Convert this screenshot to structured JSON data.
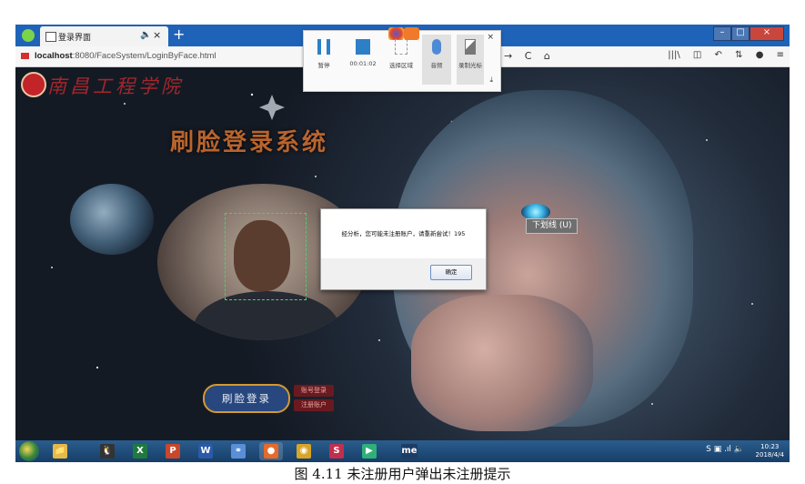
{
  "browser": {
    "tab_title": "登录界面",
    "tab_audio": "🔈",
    "tab_close": "×",
    "new_tab": "+",
    "url_host": "localhost",
    "url_path": ":8080/FaceSystem/LoginByFace.html",
    "window": {
      "minimize": "–",
      "maximize": "□",
      "close": "×"
    },
    "nav_icons": {
      "forward": "→",
      "reload": "C",
      "home": "⌂"
    },
    "right_icons": {
      "library": "|||\\",
      "sidebar": "◫",
      "undo": "↶",
      "tools": "⇅",
      "chat": "●",
      "menu": "≡"
    }
  },
  "recorder": {
    "pause_label": "暂停",
    "timer": "00:01:02",
    "area_label": "选择区域",
    "audio_label": "音频",
    "cursor_label": "录制光标",
    "close": "×",
    "pin": "⤓"
  },
  "page": {
    "logo_text": "南昌工程学院",
    "title": "刷脸登录系统",
    "login_button": "刷脸登录",
    "account_login": "账号登录",
    "register_account": "注册账户"
  },
  "dialog": {
    "message": "经分析，您可能未注册账户，请重新尝试！195",
    "ok_button": "确定"
  },
  "tooltip": "下划线 (U)",
  "taskbar": {
    "apps": [
      {
        "name": "explorer",
        "label": "📁",
        "color": "#e7b84a"
      },
      {
        "name": "qq",
        "label": "🐧",
        "color": "#333333"
      },
      {
        "name": "excel",
        "label": "X",
        "color": "#1f7a3f"
      },
      {
        "name": "powerpoint",
        "label": "P",
        "color": "#c9472b"
      },
      {
        "name": "word",
        "label": "W",
        "color": "#2a5aa8"
      },
      {
        "name": "network",
        "label": "⚭",
        "color": "#5a8fd8"
      },
      {
        "name": "firefox",
        "label": "●",
        "color": "#e56a2b"
      },
      {
        "name": "chrome",
        "label": "◉",
        "color": "#d9a526"
      },
      {
        "name": "app-red",
        "label": "S",
        "color": "#c22e4e"
      },
      {
        "name": "media",
        "label": "▶",
        "color": "#2fb07a"
      },
      {
        "name": "me",
        "label": "me",
        "color": "#1d3d66"
      }
    ],
    "tray_icons": "S  ▣ .ıl 🔈",
    "time": "10:23",
    "date": "2018/4/4"
  },
  "caption": "图 4.11  未注册用户弹出未注册提示"
}
